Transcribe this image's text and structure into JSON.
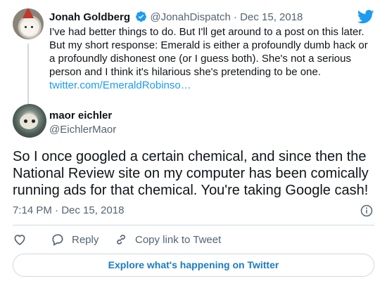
{
  "parent_tweet": {
    "author_name": "Jonah Goldberg",
    "handle": "@JonahDispatch",
    "separator": "·",
    "date": "Dec 15, 2018",
    "text": "I've had better things to do. But I'll get around to a post on this later. But my short response: Emerald is either a profoundly dumb hack or a profoundly dishonest one (or I guess both). She's not a serious person and I think it's hilarious she's pretending to be one.",
    "link": "twitter.com/EmeraldRobinso…",
    "verified_icon": "verified-badge-icon"
  },
  "main_tweet": {
    "author_name": "maor eichler",
    "handle": "@EichlerMaor",
    "text": "So I once googled a certain chemical, and since then the National Review site on my computer has been comically running ads for that chemical. You're taking Google cash!",
    "timestamp": "7:14 PM · Dec 15, 2018"
  },
  "actions": {
    "reply_label": "Reply",
    "copy_link_label": "Copy link to Tweet"
  },
  "explore_button": "Explore what's happening on Twitter",
  "colors": {
    "accent": "#1d9bf0",
    "explore_text": "#1b7bc4",
    "secondary_text": "#536471",
    "border": "#cfd9de"
  }
}
